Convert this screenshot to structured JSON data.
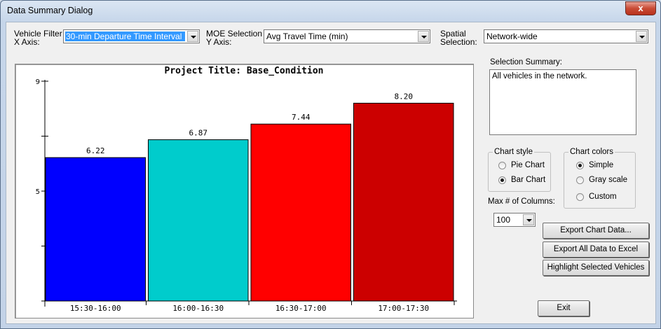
{
  "window": {
    "title": "Data Summary Dialog",
    "close_glyph": "x"
  },
  "filters": {
    "vehicle_filter_label_1": "Vehicle Filter",
    "vehicle_filter_label_2": "X Axis:",
    "vehicle_filter_value": "30-min Departure Time Interval",
    "moe_label_1": "MOE Selection",
    "moe_label_2": "Y Axis:",
    "moe_value": "Avg Travel Time (min)",
    "spatial_label_1": "Spatial",
    "spatial_label_2": "Selection:",
    "spatial_value": "Network-wide"
  },
  "summary": {
    "label": "Selection Summary:",
    "text": "All vehicles in the network."
  },
  "chart_style": {
    "legend": "Chart style",
    "options": [
      "Pie Chart",
      "Bar Chart"
    ],
    "selected": "Bar Chart"
  },
  "chart_colors": {
    "legend": "Chart colors",
    "options": [
      "Simple",
      "Gray scale",
      "Custom"
    ],
    "selected": "Simple"
  },
  "max_columns": {
    "label": "Max # of Columns:",
    "value": "100"
  },
  "buttons": {
    "export_chart": "Export Chart Data...",
    "export_all": "Export All Data to Excel",
    "highlight": "Highlight Selected Vehicles",
    "exit": "Exit"
  },
  "chart_data": {
    "type": "bar",
    "title": "Project Title: Base_Condition",
    "categories": [
      "15:30-16:00",
      "16:00-16:30",
      "16:30-17:00",
      "17:00-17:30"
    ],
    "values": [
      6.22,
      6.87,
      7.44,
      8.2
    ],
    "value_labels": [
      "6.22",
      "6.87",
      "7.44",
      "8.20"
    ],
    "bar_colors": [
      "#0000ff",
      "#00cccc",
      "#ff0000",
      "#cc0000"
    ],
    "ylim": [
      1,
      9
    ],
    "y_tick_labels": [
      "5",
      "9"
    ],
    "y_minor_ticks": [
      3,
      7
    ],
    "xlabel": "",
    "ylabel": "",
    "grid": false,
    "legend": "none"
  }
}
